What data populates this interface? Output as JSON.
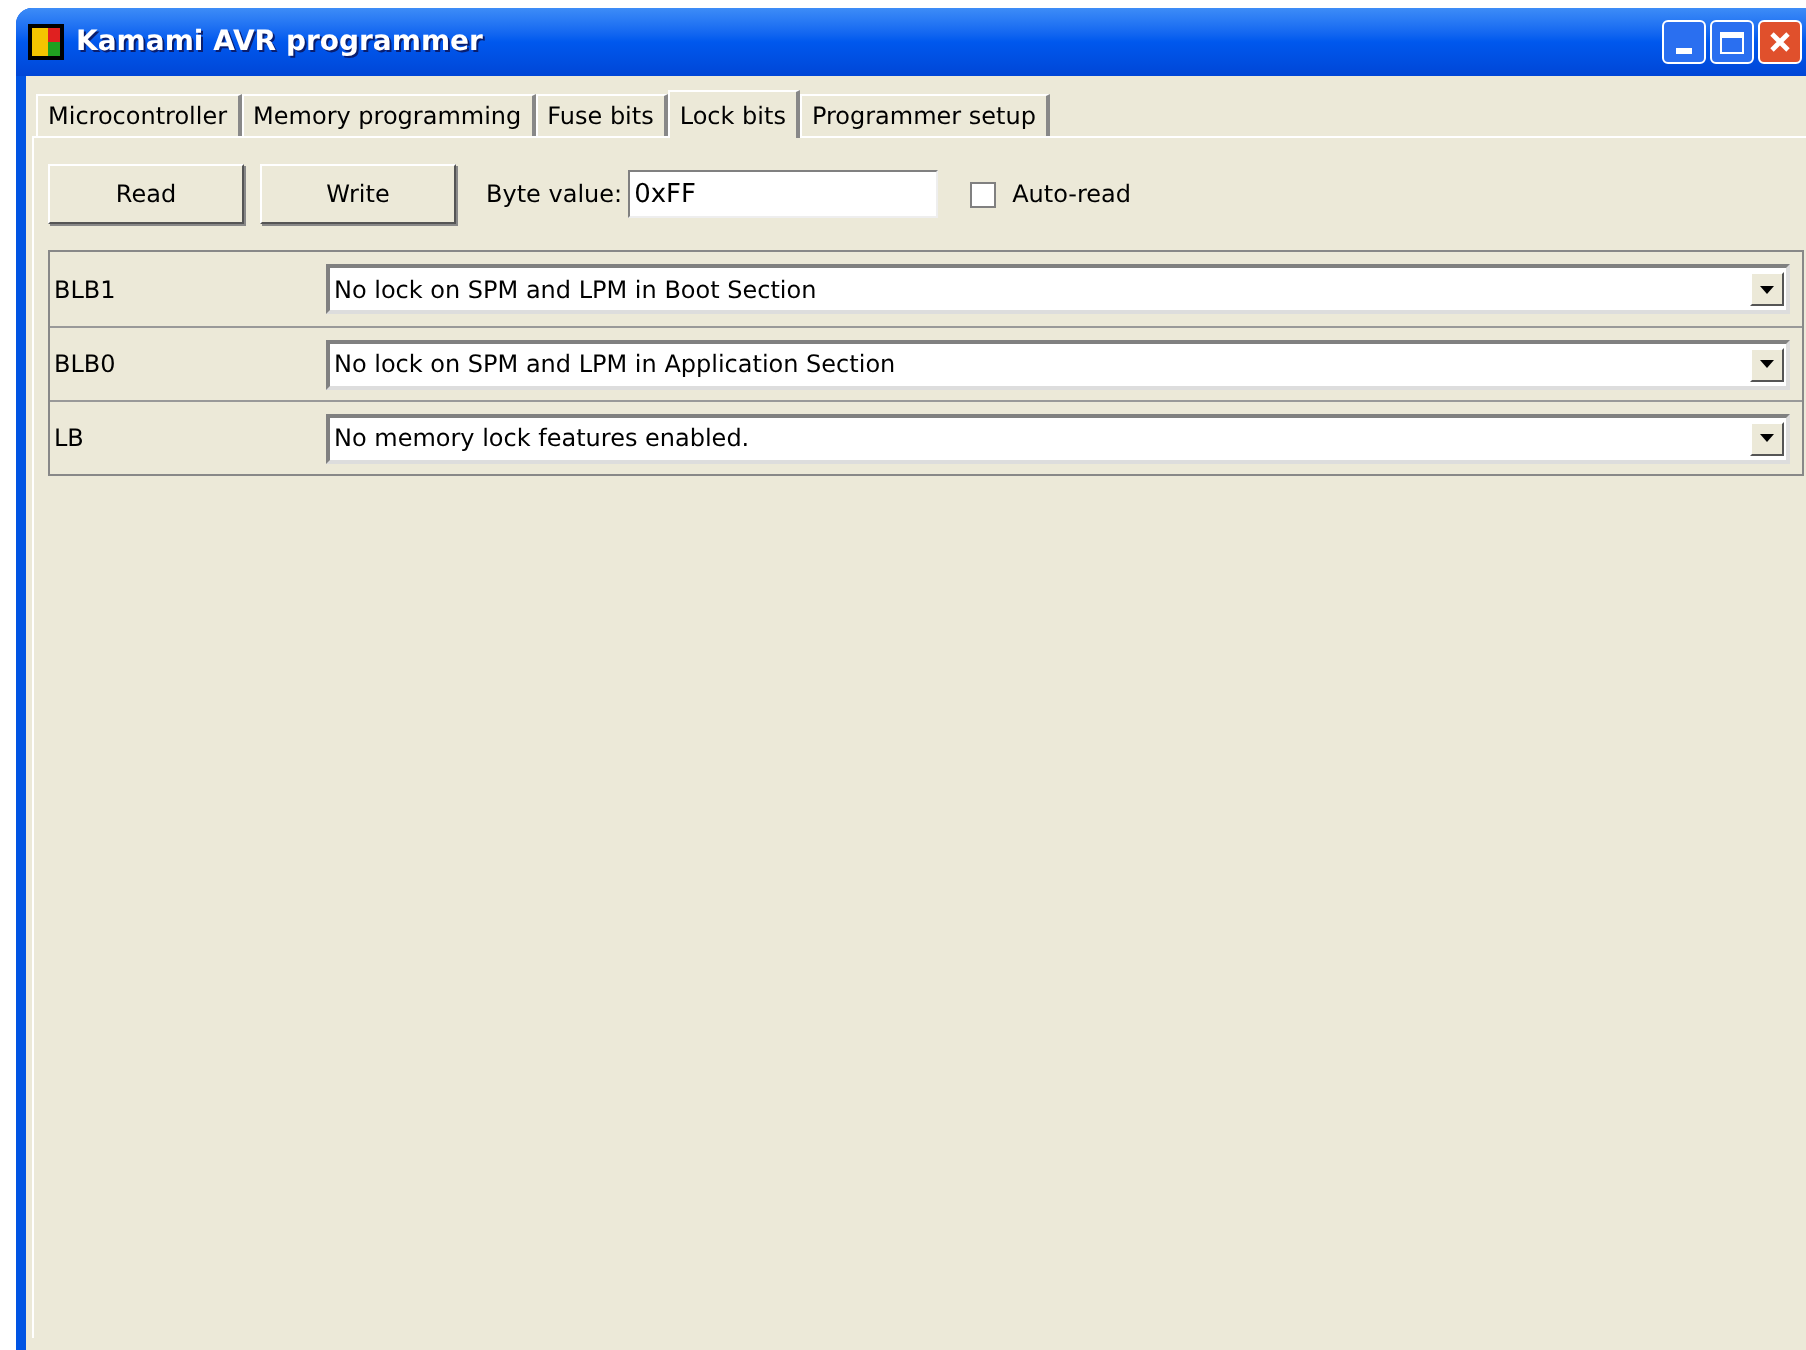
{
  "window": {
    "title": "Kamami AVR programmer"
  },
  "tabs": [
    {
      "label": "Microcontroller",
      "selected": false
    },
    {
      "label": "Memory programming",
      "selected": false
    },
    {
      "label": "Fuse bits",
      "selected": false
    },
    {
      "label": "Lock bits",
      "selected": true
    },
    {
      "label": "Programmer setup",
      "selected": false
    }
  ],
  "toolbar": {
    "read_button": "Read",
    "write_button": "Write",
    "byte_value_label": "Byte value:",
    "byte_value": "0xFF",
    "auto_read": {
      "label": "Auto-read",
      "checked": false
    }
  },
  "lock_bits": [
    {
      "name": "BLB1",
      "value": "No lock on SPM and LPM in Boot Section"
    },
    {
      "name": "BLB0",
      "value": "No lock on SPM and LPM in Application Section"
    },
    {
      "name": "LB",
      "value": "No memory lock features enabled."
    }
  ]
}
